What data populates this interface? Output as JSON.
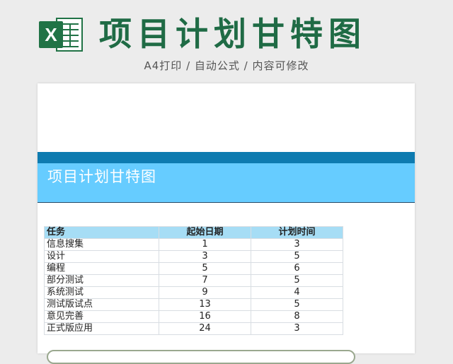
{
  "banner": {
    "logo_letter": "X",
    "title": "项目计划甘特图",
    "subtitle": "A4打印 / 自动公式 / 内容可修改"
  },
  "sheet": {
    "header_title": "项目计划甘特图",
    "table": {
      "columns": [
        "任务",
        "起始日期",
        "计划时间"
      ],
      "rows": [
        {
          "task": "信息搜集",
          "start": "1",
          "duration": "3"
        },
        {
          "task": "设计",
          "start": "3",
          "duration": "5"
        },
        {
          "task": "编程",
          "start": "5",
          "duration": "6"
        },
        {
          "task": "部分测试",
          "start": "7",
          "duration": "5"
        },
        {
          "task": "系统测试",
          "start": "9",
          "duration": "4"
        },
        {
          "task": "测试版试点",
          "start": "13",
          "duration": "5"
        },
        {
          "task": "意见完善",
          "start": "16",
          "duration": "8"
        },
        {
          "task": "正式版应用",
          "start": "24",
          "duration": "3"
        }
      ]
    }
  },
  "colors": {
    "brand_green": "#217346",
    "title_green": "#1f6b45",
    "band_dark_blue": "#0e7bb0",
    "header_light_blue": "#66ccff",
    "table_header_blue": "#a6ddf5"
  },
  "icons": {
    "logo": "excel-logo-icon"
  }
}
